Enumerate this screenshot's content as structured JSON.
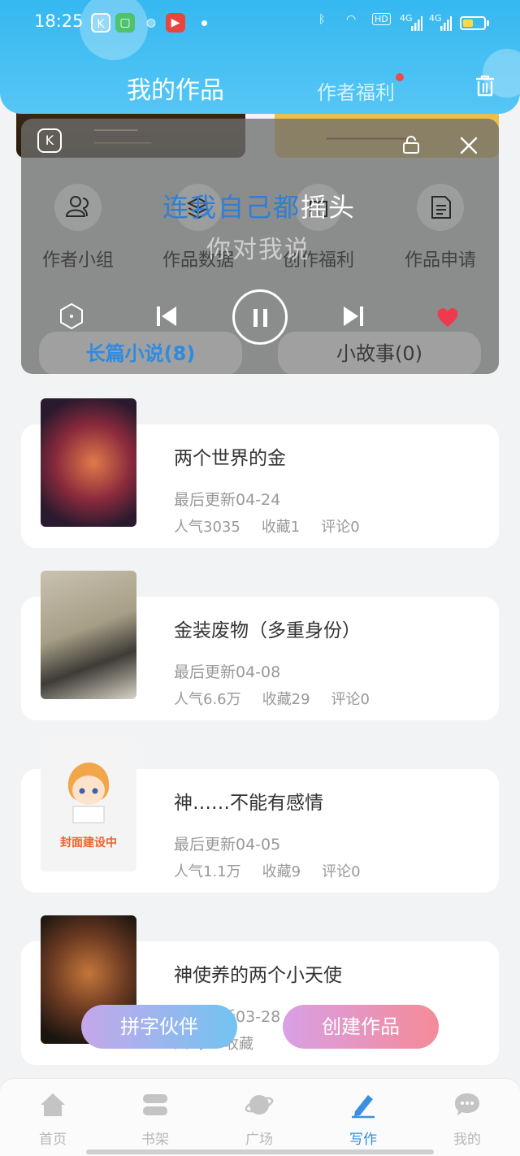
{
  "status_bar": {
    "time": "18:25",
    "net_hd": "HD",
    "net_4g_a": "4G",
    "net_4g_b": "4G"
  },
  "header": {
    "title": "我的作品",
    "secondary_tab": "作者福利"
  },
  "overlay": {
    "lyric_line1_blue": "连我自己都",
    "lyric_line1_white": "摇头",
    "lyric_line2": "你对我说",
    "categories": [
      "作者小组",
      "作品数据",
      "创作福利",
      "作品申请"
    ],
    "tabs": [
      "长篇小说(8)",
      "小故事(0)"
    ]
  },
  "works": [
    {
      "title": "两个世界的金",
      "updated": "最后更新04-24",
      "popularity": "人气3035",
      "favorites": "收藏1",
      "comments": "评论0"
    },
    {
      "title": "金装废物（多重身份）",
      "updated": "最后更新04-08",
      "popularity": "人气6.6万",
      "favorites": "收藏29",
      "comments": "评论0"
    },
    {
      "title": "神……不能有感情",
      "updated": "最后更新04-05",
      "popularity": "人气1.1万",
      "favorites": "收藏9",
      "comments": "评论0",
      "cover_text": "封面建设中"
    },
    {
      "title": "神使养的两个小天使",
      "updated": "最后更新03-28",
      "popularity": "人气",
      "favorites": "收藏",
      "comments": ""
    }
  ],
  "actions": {
    "partner": "拼字伙伴",
    "create": "创建作品"
  },
  "tabbar": [
    "首页",
    "书架",
    "广场",
    "写作",
    "我的"
  ],
  "colors": {
    "header": "#35b8f0",
    "accent": "#2f8be0",
    "red": "#f04a4a"
  }
}
